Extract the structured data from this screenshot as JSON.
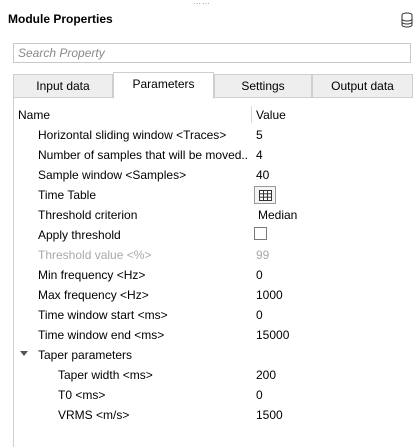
{
  "panel": {
    "title": "Module Properties",
    "icon": "database-icon"
  },
  "search": {
    "placeholder": "Search Property",
    "value": ""
  },
  "tabs": [
    {
      "label": "Input data",
      "active": false
    },
    {
      "label": "Parameters",
      "active": true
    },
    {
      "label": "Settings",
      "active": false
    },
    {
      "label": "Output data",
      "active": false
    }
  ],
  "grid": {
    "header": {
      "name": "Name",
      "value": "Value"
    }
  },
  "rows": [
    {
      "name": "Horizontal sliding window <Traces>",
      "value": "5"
    },
    {
      "name": "Number of samples that will be moved...",
      "value": "4"
    },
    {
      "name": "Sample window <Samples>",
      "value": "40"
    },
    {
      "name": "Time Table",
      "value": "",
      "icon": "table-icon"
    },
    {
      "name": "Threshold criterion",
      "value": "Median"
    },
    {
      "name": "Apply threshold",
      "value": "",
      "checked": false
    },
    {
      "name": "Threshold value <%>",
      "value": "99",
      "disabled": true
    },
    {
      "name": "Min frequency <Hz>",
      "value": "0"
    },
    {
      "name": "Max frequency <Hz>",
      "value": "1000"
    },
    {
      "name": "Time window start <ms>",
      "value": "0"
    },
    {
      "name": "Time window end <ms>",
      "value": "15000"
    },
    {
      "name": "Taper parameters",
      "value": "",
      "expanded": true,
      "group": true
    },
    {
      "name": "Taper width <ms>",
      "value": "200"
    },
    {
      "name": "T0 <ms>",
      "value": "0"
    },
    {
      "name": "VRMS <m/s>",
      "value": "1500"
    }
  ]
}
